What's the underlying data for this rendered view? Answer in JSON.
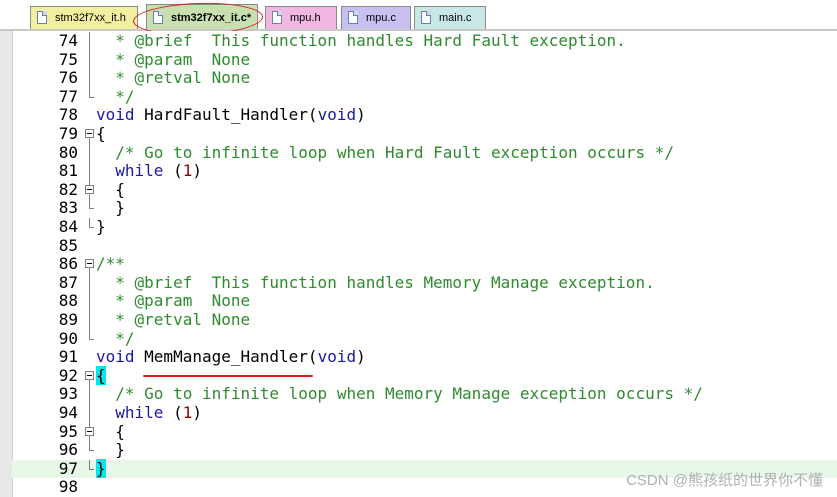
{
  "tabs": [
    {
      "label": "stm32f7xx_it.h",
      "active": false,
      "color": "#f2f0a0"
    },
    {
      "label": "stm32f7xx_it.c*",
      "active": true,
      "color": "#c8e0b0"
    },
    {
      "label": "mpu.h",
      "active": false,
      "color": "#f0b8e0"
    },
    {
      "label": "mpu.c",
      "active": false,
      "color": "#c8c0f0"
    },
    {
      "label": "main.c",
      "active": false,
      "color": "#c8e8e8"
    }
  ],
  "lines": [
    {
      "n": "74",
      "code": "  * @brief  This function handles Hard Fault exception."
    },
    {
      "n": "75",
      "code": "  * @param  None"
    },
    {
      "n": "76",
      "code": "  * @retval None"
    },
    {
      "n": "77",
      "code": "  */"
    },
    {
      "n": "78",
      "code": "void HardFault_Handler(void)"
    },
    {
      "n": "79",
      "code": "{"
    },
    {
      "n": "80",
      "code": "  /* Go to infinite loop when Hard Fault exception occurs */"
    },
    {
      "n": "81",
      "code": "  while (1)"
    },
    {
      "n": "82",
      "code": "  {"
    },
    {
      "n": "83",
      "code": "  }"
    },
    {
      "n": "84",
      "code": "}"
    },
    {
      "n": "85",
      "code": ""
    },
    {
      "n": "86",
      "code": "/**"
    },
    {
      "n": "87",
      "code": "  * @brief  This function handles Memory Manage exception."
    },
    {
      "n": "88",
      "code": "  * @param  None"
    },
    {
      "n": "89",
      "code": "  * @retval None"
    },
    {
      "n": "90",
      "code": "  */"
    },
    {
      "n": "91",
      "code": "void MemManage_Handler(void)"
    },
    {
      "n": "92",
      "code": "{"
    },
    {
      "n": "93",
      "code": "  /* Go to infinite loop when Memory Manage exception occurs */"
    },
    {
      "n": "94",
      "code": "  while (1)"
    },
    {
      "n": "95",
      "code": "  {"
    },
    {
      "n": "96",
      "code": "  }"
    },
    {
      "n": "97",
      "code": "}"
    },
    {
      "n": "98",
      "code": ""
    }
  ],
  "watermark": "CSDN @熊孩纸的世界你不懂",
  "colors": {
    "comment": "#2e8b2e",
    "keyword": "#1a1aa0",
    "number": "#8b0000",
    "annotation": "#d42020",
    "current_line": "#e8f8e8"
  }
}
